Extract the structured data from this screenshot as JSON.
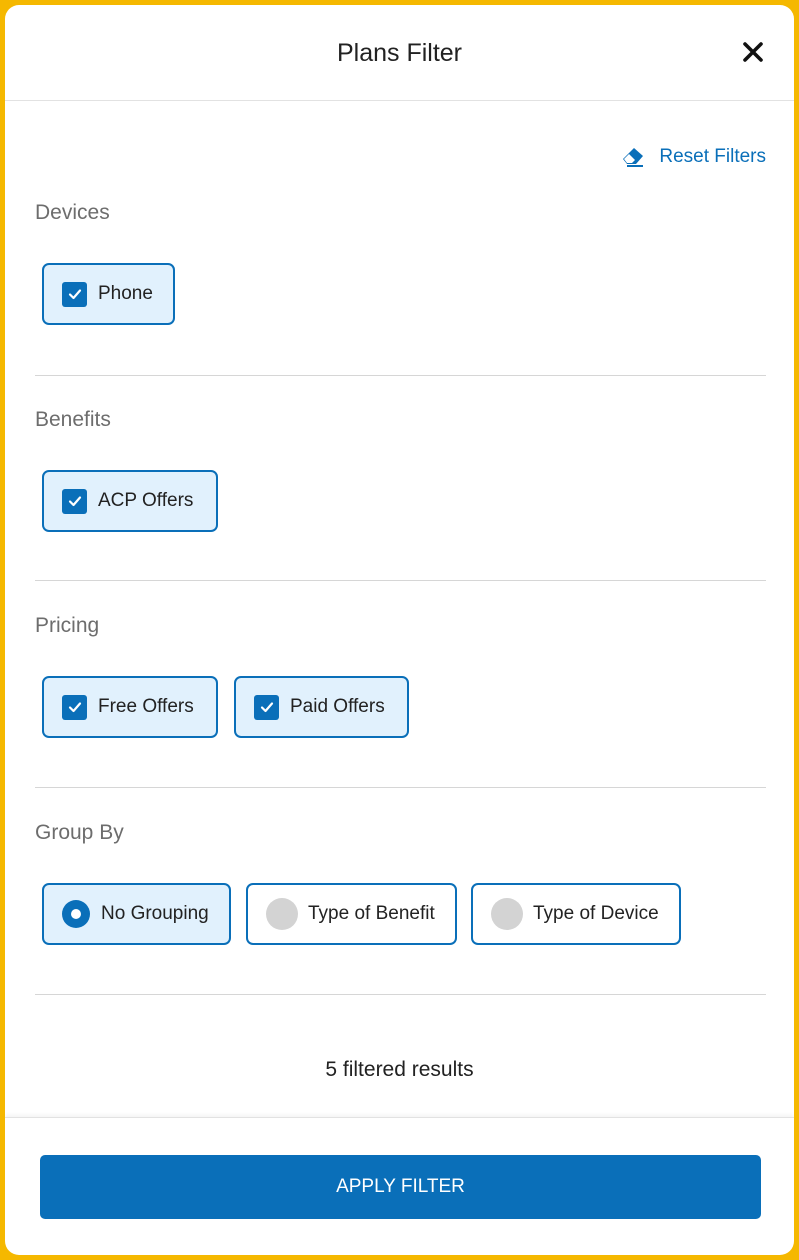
{
  "header": {
    "title": "Plans Filter"
  },
  "reset": {
    "label": "Reset Filters"
  },
  "sections": {
    "devices": {
      "title": "Devices",
      "options": [
        {
          "label": "Phone",
          "checked": true
        }
      ]
    },
    "benefits": {
      "title": "Benefits",
      "options": [
        {
          "label": "ACP Offers",
          "checked": true
        }
      ]
    },
    "pricing": {
      "title": "Pricing",
      "options": [
        {
          "label": "Free Offers",
          "checked": true
        },
        {
          "label": "Paid Offers",
          "checked": true
        }
      ]
    },
    "group_by": {
      "title": "Group By",
      "options": [
        {
          "label": "No Grouping",
          "selected": true
        },
        {
          "label": "Type of Benefit",
          "selected": false
        },
        {
          "label": "Type of Device",
          "selected": false
        }
      ]
    }
  },
  "results": {
    "text": "5 filtered results"
  },
  "footer": {
    "apply_label": "APPLY FILTER"
  },
  "icons": {
    "close": "close-icon",
    "reset": "eraser-icon",
    "check": "checkmark-icon",
    "radio_on": "radio-selected-icon",
    "radio_off": "radio-unselected-icon"
  },
  "colors": {
    "accent": "#0a6fb9",
    "chip_selected_bg": "#e1f1fd",
    "frame": "#f5b800",
    "radio_off": "#d3d3d3"
  }
}
